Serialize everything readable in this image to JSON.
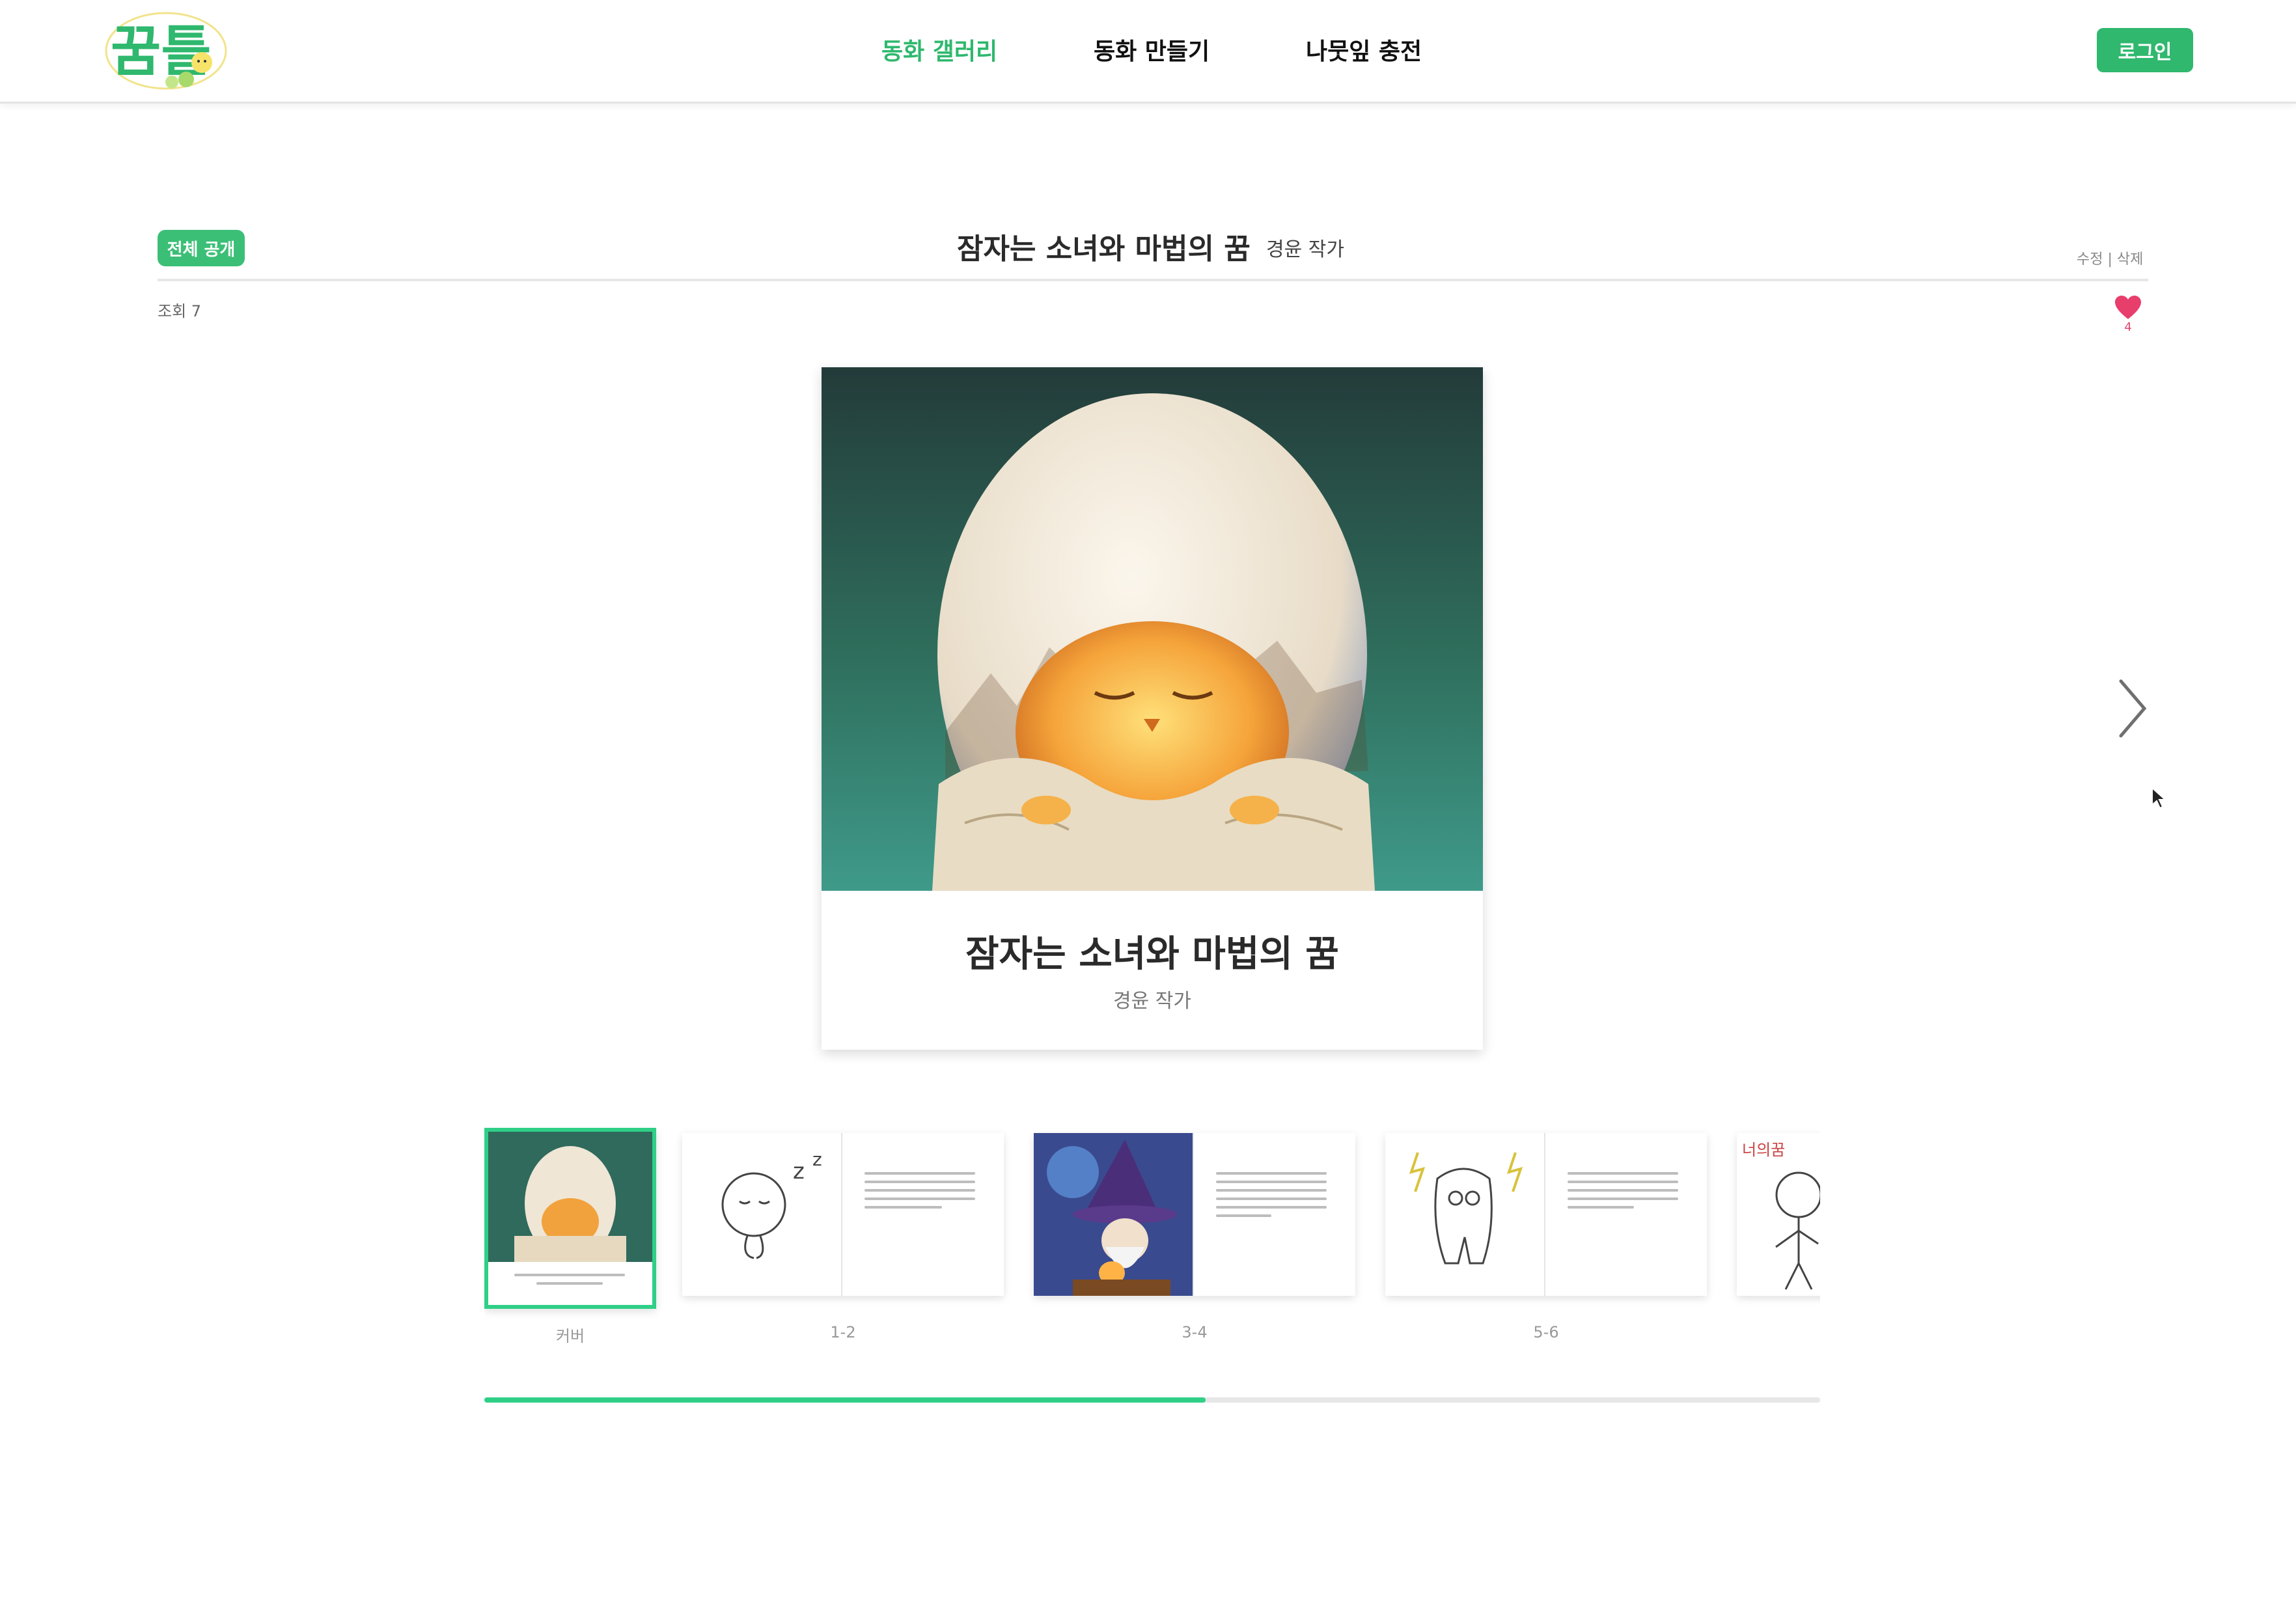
{
  "header": {
    "logo_text": "꿈틀",
    "nav": [
      "동화 갤러리",
      "동화 만들기",
      "나뭇잎 충전"
    ],
    "active_nav": "동화 갤러리",
    "login_label": "로그인"
  },
  "book": {
    "visibility_badge": "전체 공개",
    "title": "잠자는 소녀와 마법의 꿈",
    "author": "경윤 작가",
    "edit_links": "수정 | 삭제",
    "views": "조회 7",
    "likes": "4"
  },
  "viewer": {
    "cover_title": "잠자는 소녀와 마법의 꿈",
    "cover_author": "경윤 작가",
    "icons": [
      "heart-icon",
      "chevron-right-icon",
      "mouse-cursor-icon"
    ]
  },
  "thumbnails": [
    {
      "label": "커버"
    },
    {
      "label": "1-2"
    },
    {
      "label": "3-4"
    },
    {
      "label": "5-6"
    },
    {
      "label": ""
    }
  ],
  "thumbnail_sketch_text": "너의꿈",
  "progress": {
    "scrolled_fraction": 0.54
  },
  "colors": {
    "accent": "#2fb86e",
    "progress": "#2fcf87",
    "heart": "#e0446b"
  }
}
